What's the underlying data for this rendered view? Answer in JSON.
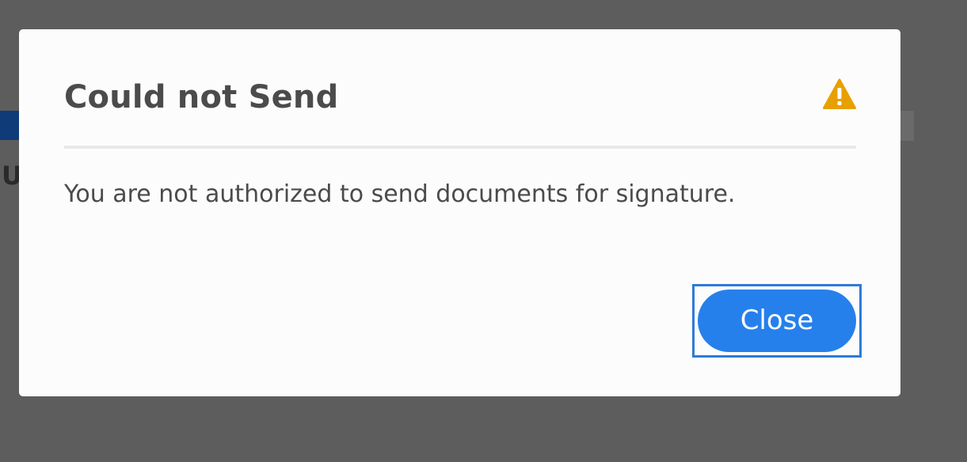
{
  "dialog": {
    "title": "Could not Send",
    "message": "You are not authorized to send documents for signature.",
    "icon": "warning-icon",
    "close_label": "Close"
  },
  "background": {
    "partial_text": "U"
  },
  "colors": {
    "overlay": "#5d5d5d",
    "dialog_bg": "#fcfcfc",
    "title_text": "#4b4b4b",
    "warning_icon": "#e8a000",
    "button_bg": "#2680eb",
    "button_text": "#ffffff",
    "focus_ring": "#2d7ad8",
    "divider": "#e9e9e9"
  }
}
